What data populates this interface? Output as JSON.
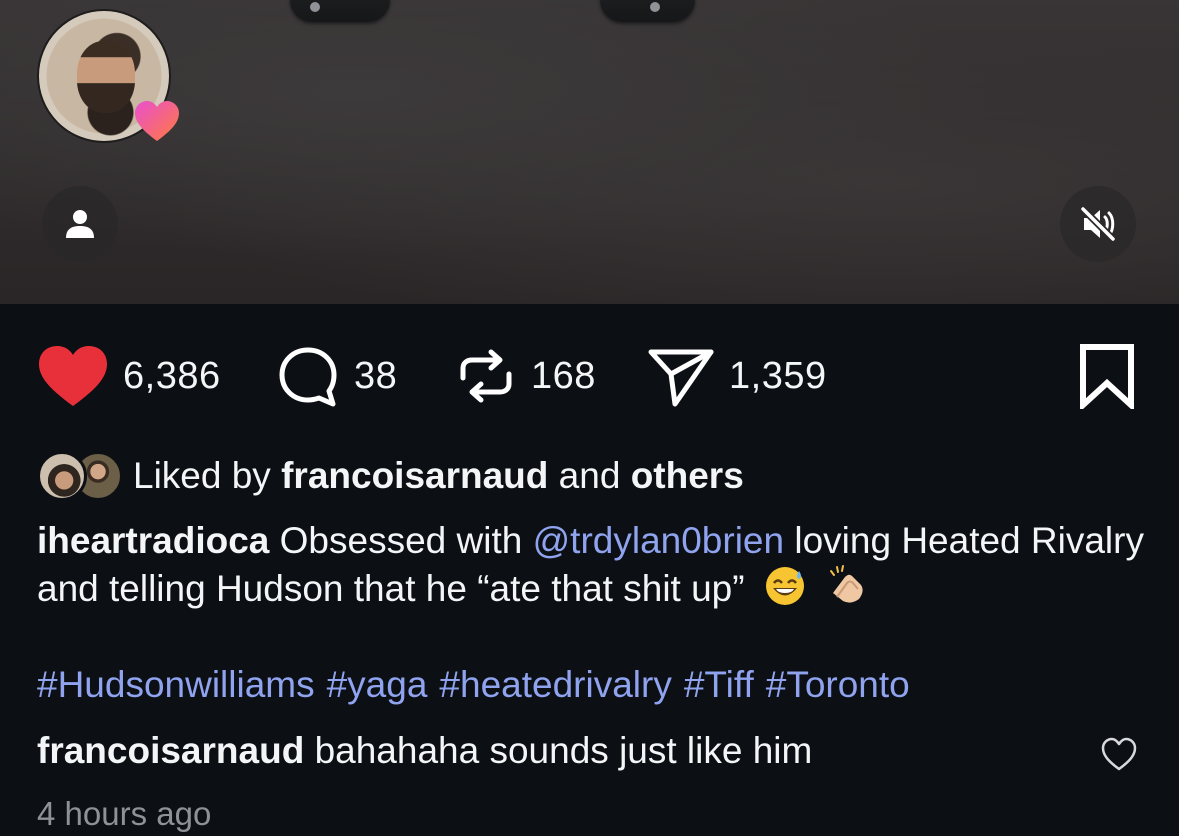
{
  "post": {
    "author_avatar_icon": "avatar-photo",
    "profile_icon": "person-icon",
    "mute_icon": "speaker-muted-icon"
  },
  "actions": {
    "likes": "6,386",
    "comments": "38",
    "reposts": "168",
    "shares": "1,359",
    "like_color": "#e8303a"
  },
  "liked_by": {
    "prefix": "Liked by",
    "user": "francoisarnaud",
    "middle": "and",
    "others": "others"
  },
  "caption": {
    "author": "iheartradioca",
    "text_before": "Obsessed with",
    "mention": "@trdylan0brien",
    "text_after": "loving Heated Rivalry and telling Hudson that he “ate that shit up”",
    "hashtags": [
      "#Hudsonwilliams",
      "#yaga",
      "#heatedrivalry",
      "#Tiff",
      "#Toronto"
    ]
  },
  "comment": {
    "author": "francoisarnaud",
    "text": "bahahaha sounds just like him"
  },
  "timestamp": "4 hours ago",
  "colors": {
    "mention": "#8fa3ee",
    "background": "#0c0f14",
    "muted_text": "#8e9196"
  }
}
